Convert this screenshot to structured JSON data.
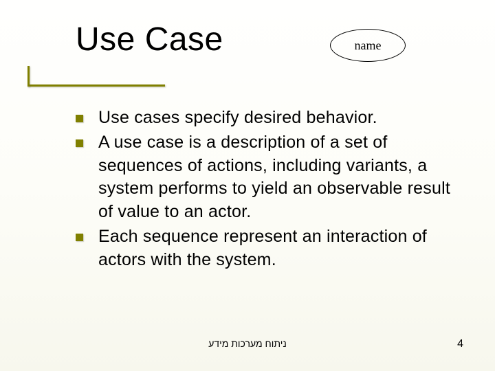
{
  "title": "Use Case",
  "oval_label": "name",
  "bullets": [
    "Use cases specify desired behavior.",
    "A use case is a description of a set of sequences of actions, including variants, a system performs to yield an observable result of value to an actor.",
    "Each sequence represent an interaction of actors with the system."
  ],
  "footer": {
    "center": "ניתוח מערכות מידע",
    "page": "4"
  }
}
